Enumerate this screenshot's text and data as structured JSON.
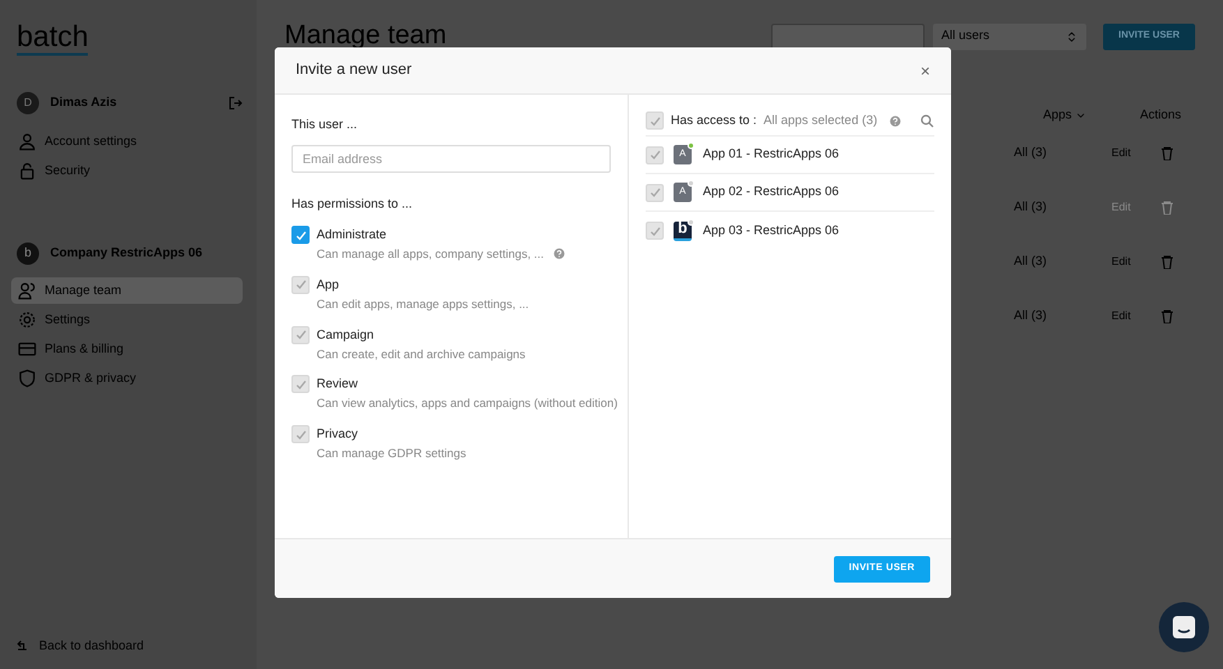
{
  "sidebar": {
    "logo": "batch",
    "user": {
      "initial": "D",
      "name": "Dimas Azis"
    },
    "account_items": [
      {
        "label": "Account settings",
        "selected": false
      },
      {
        "label": "Security",
        "selected": false
      }
    ],
    "company": {
      "initial": "b",
      "name": "Company RestricApps 06"
    },
    "company_items": [
      {
        "label": "Manage team",
        "selected": true
      },
      {
        "label": "Settings",
        "selected": false
      },
      {
        "label": "Plans & billing",
        "selected": false
      },
      {
        "label": "GDPR & privacy",
        "selected": false
      }
    ],
    "back_link": "Back to dashboard"
  },
  "page": {
    "title": "Manage team",
    "filter": "All users",
    "invite_button": "INVITE USER",
    "columns": [
      "Apps",
      "Actions"
    ],
    "rows": [
      {
        "apps": "All (3)",
        "edit": "Edit",
        "disabled": false
      },
      {
        "apps": "All (3)",
        "edit": "Edit",
        "disabled": true
      },
      {
        "apps": "All (3)",
        "edit": "Edit",
        "disabled": false
      },
      {
        "apps": "All (3)",
        "edit": "Edit",
        "disabled": false
      }
    ]
  },
  "dialog": {
    "title": "Invite a new user",
    "close": "×",
    "user_label": "This user ...",
    "email": {
      "placeholder": "Email address"
    },
    "permissions_label": "Has permissions to ...",
    "permissions": [
      {
        "name": "Administrate",
        "description": "Can manage all apps, company settings, ...",
        "checked": true,
        "disabled": false,
        "help": true
      },
      {
        "name": "App",
        "description": "Can edit apps, manage apps settings, ...",
        "checked": true,
        "disabled": true,
        "help": false
      },
      {
        "name": "Campaign",
        "description": "Can create, edit and archive campaigns",
        "checked": true,
        "disabled": true,
        "help": false
      },
      {
        "name": "Review",
        "description": "Can view analytics, apps and campaigns (without edition)",
        "checked": true,
        "disabled": true,
        "help": false
      },
      {
        "name": "Privacy",
        "description": "Can manage GDPR settings",
        "checked": true,
        "disabled": true,
        "help": false
      }
    ],
    "access": {
      "label": "Has access to :",
      "value": "All apps selected (3)",
      "checked": true,
      "disabled": true
    },
    "apps": [
      {
        "name": "App 01 - RestricApps 06",
        "icon_text": "A",
        "kind": "letter",
        "color": "#7cc243",
        "checked": true,
        "disabled": true
      },
      {
        "name": "App 02 - RestricApps 06",
        "icon_text": "A",
        "kind": "letter",
        "color": "#d4d4d4",
        "checked": true,
        "disabled": true
      },
      {
        "name": "App 03 - RestricApps 06",
        "icon_text": "b",
        "kind": "logo",
        "color": "#d4d4d4",
        "checked": true,
        "disabled": true
      }
    ],
    "submit": "INVITE USER"
  }
}
